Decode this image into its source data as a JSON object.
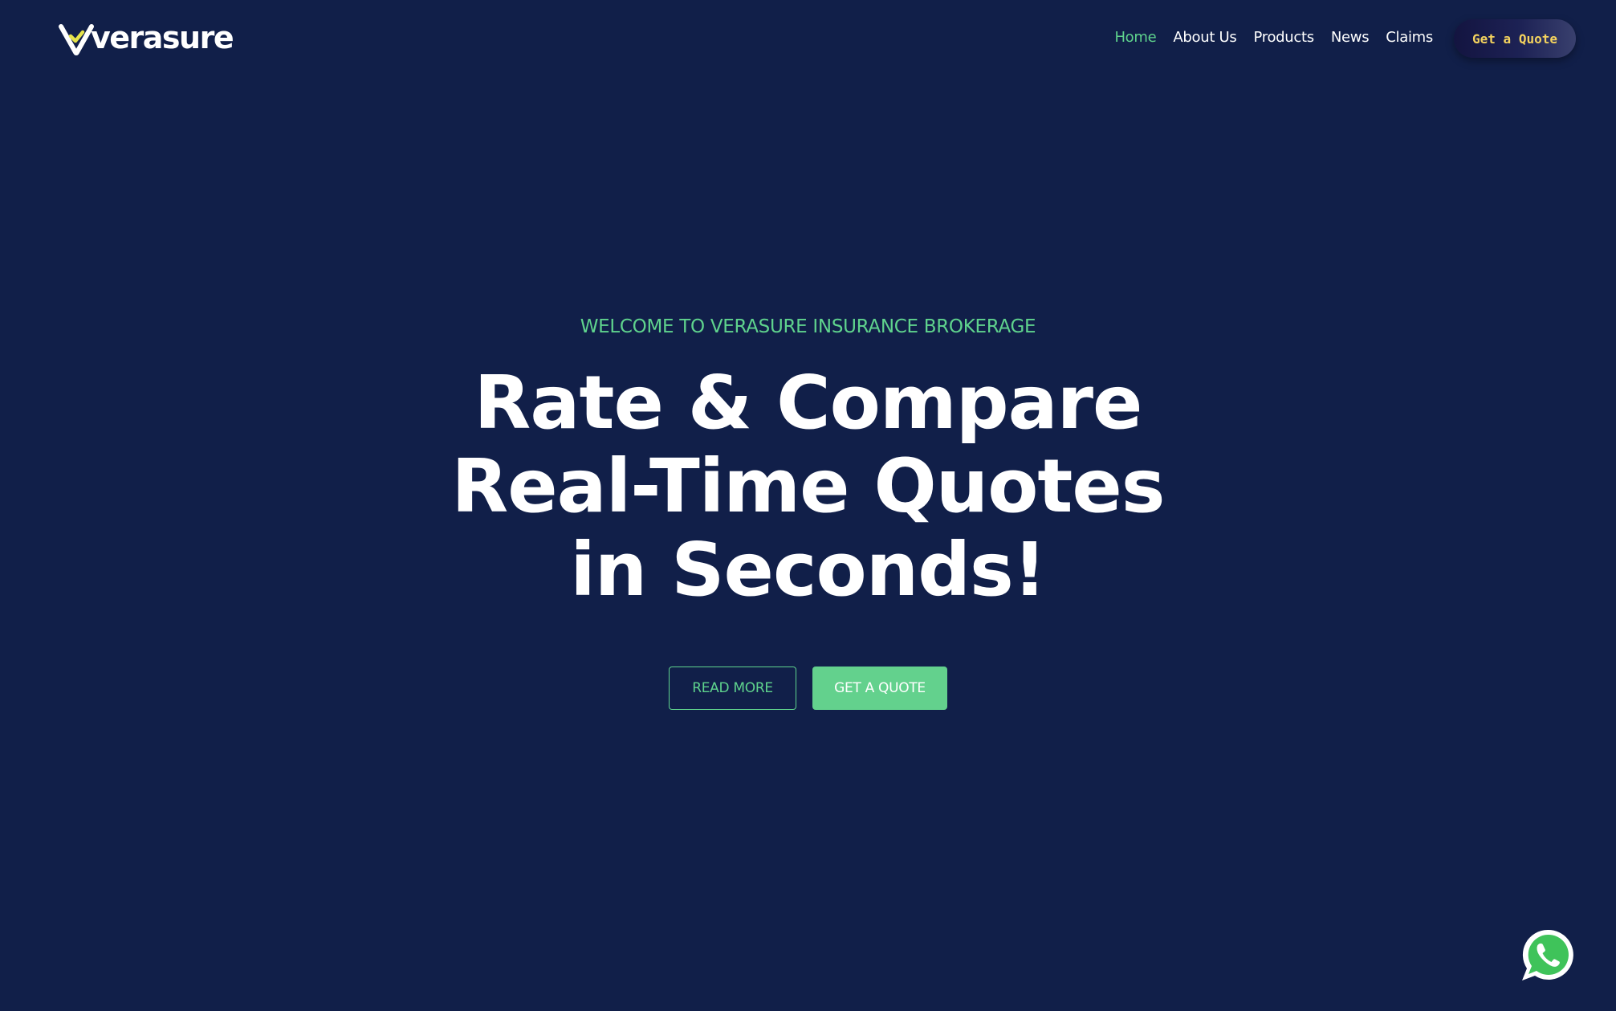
{
  "header": {
    "logo_text": "verasure",
    "nav": [
      {
        "label": "Home",
        "active": true
      },
      {
        "label": "About Us",
        "active": false
      },
      {
        "label": "Products",
        "active": false
      },
      {
        "label": "News",
        "active": false
      },
      {
        "label": "Claims",
        "active": false
      }
    ],
    "quote_button": "Get a Quote"
  },
  "hero": {
    "eyebrow": "WELCOME TO VERASURE INSURANCE BROKERAGE",
    "headline_lines": [
      "Rate & Compare",
      "Real-Time Quotes",
      "in Seconds!"
    ],
    "read_more": "READ MORE",
    "get_quote": "GET A QUOTE"
  },
  "floating": {
    "icon": "whatsapp-icon"
  },
  "colors": {
    "background": "#111f49",
    "accent_green": "#5fd38d",
    "button_green": "#63d18d",
    "pill_text": "#f4d35e",
    "text": "#ffffff"
  }
}
